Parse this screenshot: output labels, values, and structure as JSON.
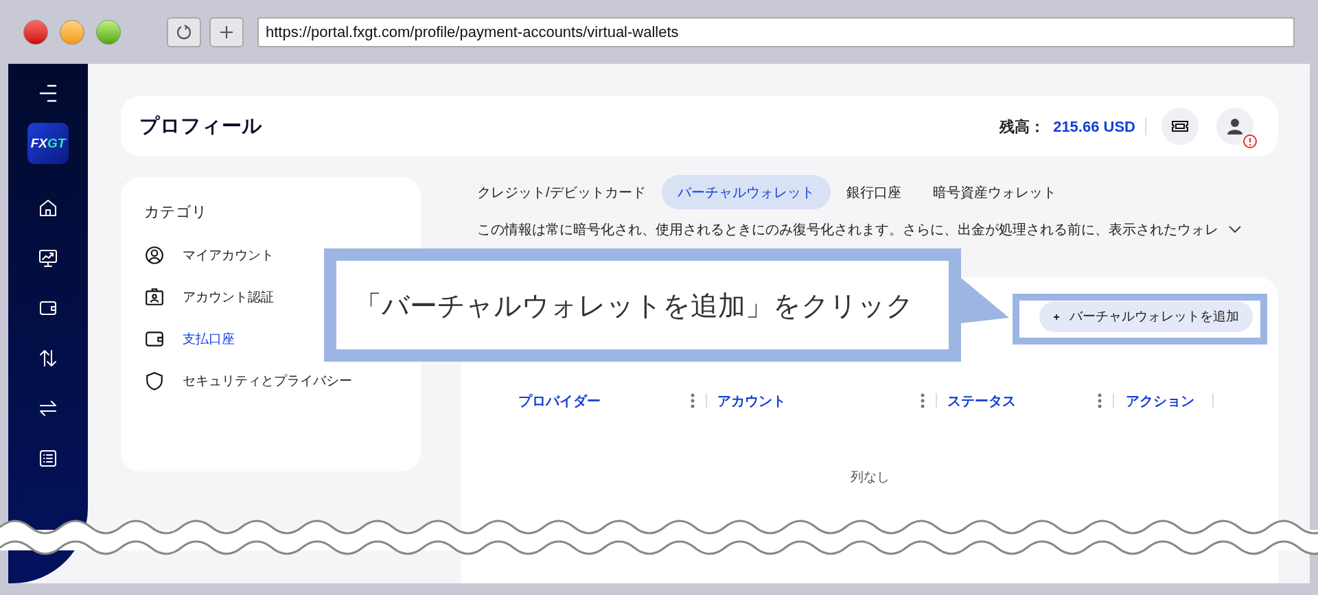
{
  "browser": {
    "url": "https://portal.fxgt.com/profile/payment-accounts/virtual-wallets"
  },
  "sidebar": {
    "logo": {
      "first": "FX",
      "second": "GT"
    }
  },
  "header": {
    "title": "プロフィール",
    "balance_label": "残高：",
    "balance_value": "215.66 USD"
  },
  "category": {
    "title": "カテゴリ",
    "items": [
      {
        "label": "マイアカウント",
        "selected": false
      },
      {
        "label": "アカウント認証",
        "selected": false
      },
      {
        "label": "支払口座",
        "selected": true
      },
      {
        "label": "セキュリティとプライバシー",
        "selected": false
      }
    ]
  },
  "tabs": [
    {
      "label": "クレジット/デビットカード",
      "selected": false
    },
    {
      "label": "バーチャルウォレット",
      "selected": true
    },
    {
      "label": "銀行口座",
      "selected": false
    },
    {
      "label": "暗号資産ウォレット",
      "selected": false
    }
  ],
  "notice": {
    "text": "この情報は常に暗号化され、使用されるときにのみ復号化されます。さらに、出金が処理される前に、表示されたウォレ",
    "expanded": false
  },
  "add_button": {
    "label": "バーチャルウォレットを追加"
  },
  "table": {
    "columns": [
      "プロバイダー",
      "アカウント",
      "ステータス",
      "アクション"
    ],
    "empty_text": "列なし"
  },
  "callout": {
    "text": "「バーチャルウォレットを追加」をクリック"
  }
}
